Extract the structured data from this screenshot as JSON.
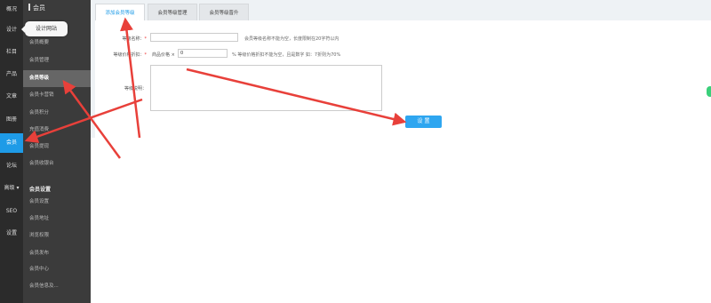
{
  "rail": {
    "items": [
      {
        "label": "概况"
      },
      {
        "label": "设计"
      },
      {
        "label": "栏目"
      },
      {
        "label": "产品"
      },
      {
        "label": "文章"
      },
      {
        "label": "图册"
      },
      {
        "label": "会员"
      },
      {
        "label": "论坛"
      },
      {
        "label": "高级"
      },
      {
        "label": "SEO"
      },
      {
        "label": "设置"
      }
    ]
  },
  "submenu": {
    "title": "会员",
    "items": [
      {
        "label": "会员概要"
      },
      {
        "label": "会员管理"
      },
      {
        "label": "会员等级"
      },
      {
        "label": "会员卡营销"
      },
      {
        "label": "会员积分"
      },
      {
        "label": "充值消费"
      },
      {
        "label": "会员提现"
      },
      {
        "label": "会员收银台"
      }
    ],
    "section_title": "会员设置",
    "settings_items": [
      {
        "label": "会员设置"
      },
      {
        "label": "会员地址"
      },
      {
        "label": "浏览权限"
      },
      {
        "label": "会员发布"
      },
      {
        "label": "会员中心"
      },
      {
        "label": "会员信息及..."
      }
    ]
  },
  "tooltip": {
    "label": "设计网站"
  },
  "tabs": [
    {
      "label": "添加会员等级"
    },
    {
      "label": "会员等级管理"
    },
    {
      "label": "会员等级晋升"
    }
  ],
  "form": {
    "name_label": "等级名称：",
    "name_required": "*",
    "name_hint": "会员等级名称不能为空，长度限制在20字符以内",
    "discount_label": "等级价格折扣：",
    "discount_required": "*",
    "discount_prefix": "商品价格 ×",
    "discount_value": "0",
    "discount_hint": "% 等级价格折扣不能为空，且是数字 如：7折则为70%",
    "desc_label": "等级说明：",
    "submit_label": "设 置"
  },
  "colors": {
    "rail_bg": "#2b2b2b",
    "submenu_bg": "#3b3b3b",
    "accent": "#1e9be7",
    "arrow": "#e8403a"
  }
}
